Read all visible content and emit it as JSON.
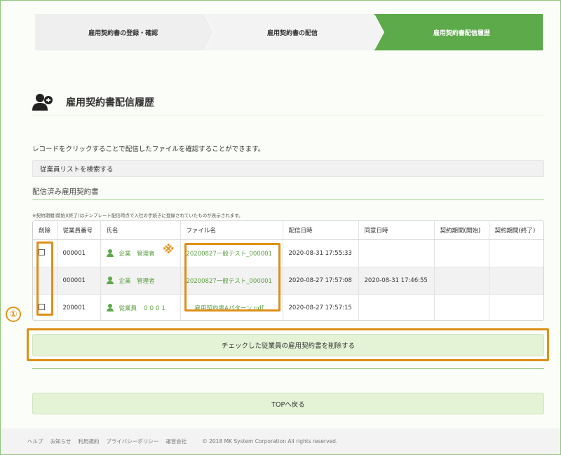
{
  "stepper": {
    "steps": [
      {
        "label": "雇用契約書の登録・確認"
      },
      {
        "label": "雇用契約書の配信"
      },
      {
        "label": "雇用契約書配信履歴"
      }
    ]
  },
  "page": {
    "title": "雇用契約書配信履歴",
    "description": "レコードをクリックすることで配信したファイルを確認することができます。",
    "search_label": "従業員リストを検索する",
    "section_title": "配信済み雇用契約書",
    "note": "※契約期間(開始)(終了)はテンプレート配信時点で入社の手続きに登録されていたものが表示されます。"
  },
  "table": {
    "headers": [
      "削除",
      "従業員番号",
      "氏名",
      "ファイル名",
      "配信日時",
      "同意日時",
      "契約期間(開始)",
      "契約期間(終了)"
    ],
    "rows": [
      {
        "checkbox": true,
        "number": "000001",
        "name": "企業　管理者",
        "file": "20200827一般テスト_000001",
        "sent": "2020-08-31 17:55:33",
        "agreed": "",
        "start": "",
        "end": ""
      },
      {
        "checkbox": false,
        "number": "000001",
        "name": "企業　管理者",
        "file": "20200827一般テスト_000001",
        "sent": "2020-08-27 17:57:08",
        "agreed": "2020-08-31 17:46:55",
        "start": "",
        "end": ""
      },
      {
        "checkbox": true,
        "number": "200001",
        "name": "従業員　０００１",
        "file": "雇用契約書Aパターン.pdf",
        "sent": "2020-08-27 17:57:15",
        "agreed": "",
        "start": "",
        "end": ""
      }
    ]
  },
  "annotations": {
    "kome": "※",
    "circle_number": "①",
    "highlight_color": "#de8f17"
  },
  "buttons": {
    "delete_label": "チェックした従業員の雇用契約書を削除する",
    "top_label": "TOPへ戻る"
  },
  "footer": {
    "links": [
      "ヘルプ",
      "お知らせ",
      "利用規約",
      "プライバシーポリシー",
      "運営会社"
    ],
    "copyright": "© 2018 MK System Corporation All rights reserved."
  },
  "colors": {
    "accent": "#5daa4a",
    "button_bg": "#e4f3d6",
    "link": "#5a9e3f"
  },
  "icons": {
    "title_icon": "add-user-icon",
    "person_icon": "person-icon"
  }
}
